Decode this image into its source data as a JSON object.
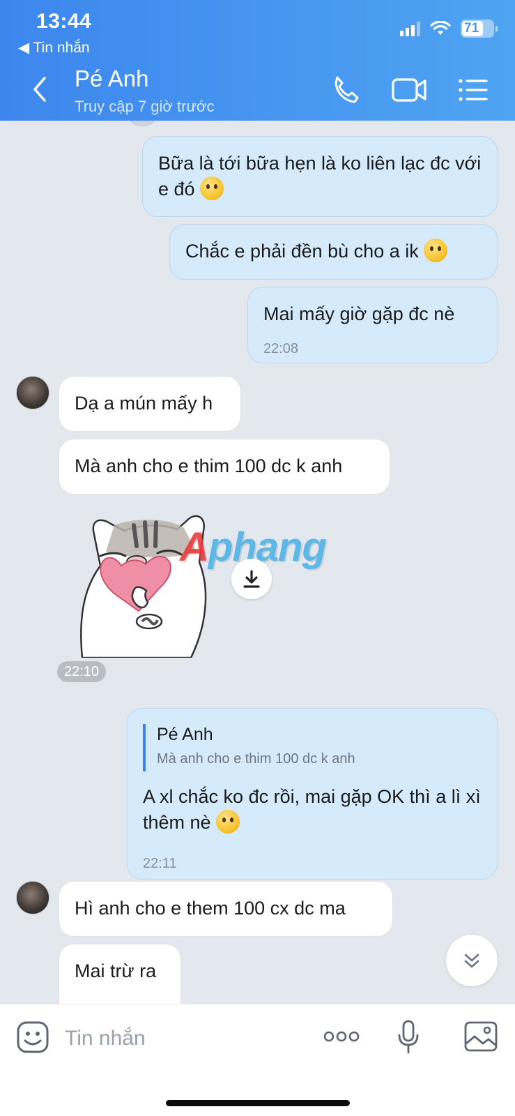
{
  "status_bar": {
    "time": "13:44",
    "back_app": "◀ Tin nhắn",
    "battery": "71"
  },
  "header": {
    "contact_name": "Pé Anh",
    "contact_status": "Truy cập 7 giờ trước"
  },
  "messages": [
    {
      "dir": "out",
      "text": "Bữa là tới bữa hẹn là ko liên lạc đc với e đó"
    },
    {
      "dir": "out",
      "text": "Chắc e phải đền bù cho a ik"
    },
    {
      "dir": "out",
      "text": "Mai mấy giờ gặp đc nè",
      "time": "22:08"
    },
    {
      "dir": "in",
      "text": "Dạ a mún mấy h"
    },
    {
      "dir": "in",
      "text": "Mà anh cho e thim 100 dc k anh"
    },
    {
      "dir": "in",
      "type": "sticker",
      "time": "22:10"
    },
    {
      "dir": "out",
      "quote_name": "Pé Anh",
      "quote_text": "Mà anh cho e thim 100 dc k anh",
      "text": "A xl chắc ko đc rồi, mai gặp OK thì a lì xì thêm nè",
      "time": "22:11"
    },
    {
      "dir": "in",
      "text": "Hì anh cho e them 100 cx dc ma"
    },
    {
      "dir": "in",
      "text": "Mai trừ ra"
    }
  ],
  "watermark": {
    "first_letter": "A",
    "rest": "phang"
  },
  "input": {
    "placeholder": "Tin nhắn"
  },
  "icons": [
    "back-arrow-icon",
    "phone-icon",
    "video-icon",
    "menu-list-icon",
    "download-icon",
    "double-chevron-down-icon",
    "sticker-icon",
    "more-icon",
    "microphone-icon",
    "image-icon"
  ],
  "colors": {
    "header_start": "#3d86ee",
    "header_end": "#4fa4f1",
    "out_bubble": "#d5ebfc",
    "in_bubble": "#ffffff",
    "chat_bg": "#e3e8ef",
    "quote_bar": "#3a82e6"
  }
}
